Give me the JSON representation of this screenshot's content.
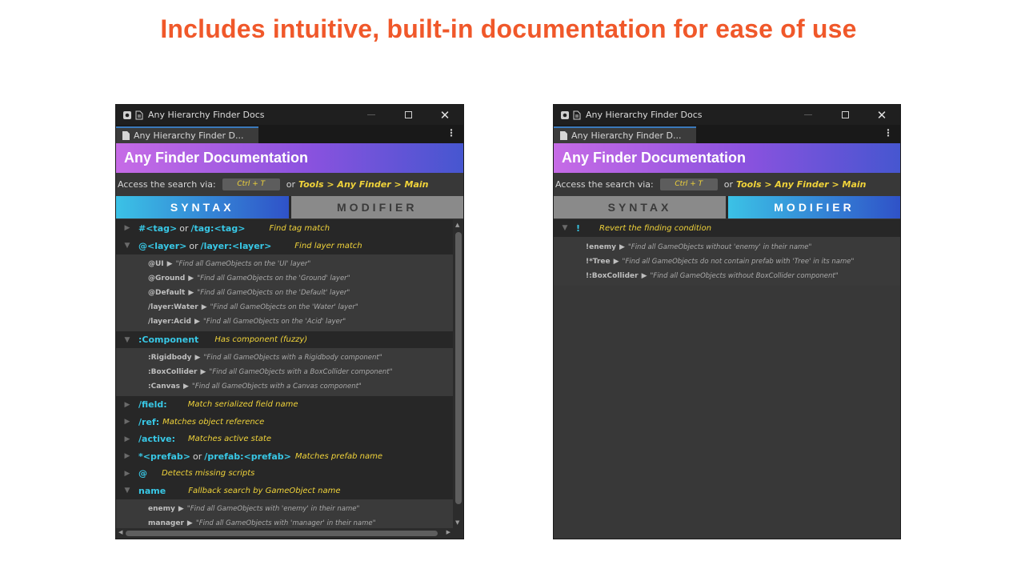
{
  "headline": "Includes intuitive, built-in documentation for ease of use",
  "colors": {
    "headline": "#f0582a",
    "key": "#38c8e6",
    "desc": "#f0d33a"
  },
  "window": {
    "title": "Any Hierarchy Finder Docs",
    "tab_label": "Any Hierarchy Finder D...",
    "header": "Any Finder Documentation",
    "access_label": "Access the search via:",
    "shortcut": "Ctrl + T",
    "or_text": "or",
    "menu_path": "Tools > Any Finder > Main",
    "tab_syntax": "SYNTAX",
    "tab_modifier": "MODIFIER",
    "example_arrow": "▶"
  },
  "syntax": {
    "tag": {
      "key1": "#<tag>",
      "or": "or",
      "key2": "/tag:<tag>",
      "desc": "Find tag match"
    },
    "layer": {
      "key1": "@<layer>",
      "or": "or",
      "key2": "/layer:<layer>",
      "desc": "Find layer match",
      "examples": [
        {
          "key": "@UI",
          "desc": "\"Find all GameObjects on the 'UI' layer\""
        },
        {
          "key": "@Ground",
          "desc": "\"Find all GameObjects on the 'Ground' layer\""
        },
        {
          "key": "@Default",
          "desc": "\"Find all GameObjects on the 'Default' layer\""
        },
        {
          "key": "/layer:Water",
          "desc": "\"Find all GameObjects on the 'Water' layer\""
        },
        {
          "key": "/layer:Acid",
          "desc": "\"Find all GameObjects on the 'Acid' layer\""
        }
      ]
    },
    "component": {
      "key": ":Component",
      "desc": "Has component (fuzzy)",
      "examples": [
        {
          "key": ":Rigidbody",
          "desc": "\"Find all GameObjects with a Rigidbody component\""
        },
        {
          "key": ":BoxCollider",
          "desc": "\"Find all GameObjects with a BoxCollider component\""
        },
        {
          "key": ":Canvas",
          "desc": "\"Find all GameObjects with a Canvas component\""
        }
      ]
    },
    "field": {
      "key": "/field:",
      "desc": "Match serialized field name"
    },
    "ref": {
      "key": "/ref:",
      "desc": "Matches object reference"
    },
    "active": {
      "key": "/active:",
      "desc": "Matches active state"
    },
    "prefab": {
      "key1": "*<prefab>",
      "or": "or",
      "key2": "/prefab:<prefab>",
      "desc": "Matches prefab name"
    },
    "missing": {
      "key": "@",
      "desc": "Detects missing scripts"
    },
    "name": {
      "key": "name",
      "desc": "Fallback search by GameObject name",
      "examples": [
        {
          "key": "enemy",
          "desc": "\"Find all GameObjects with 'enemy' in their name\""
        },
        {
          "key": "manager",
          "desc": "\"Find all GameObjects with 'manager' in their name\""
        }
      ]
    }
  },
  "modifier": {
    "key": "!",
    "desc": "Revert the finding condition",
    "examples": [
      {
        "key": "!enemy",
        "desc": "\"Find all GameObjects without 'enemy' in their name\""
      },
      {
        "key": "!*Tree",
        "desc": "\"Find all GameObjects do not contain prefab with 'Tree' in its name\""
      },
      {
        "key": "!:BoxCollider",
        "desc": "\"Find all GameObjects without BoxCollider component\""
      }
    ]
  }
}
